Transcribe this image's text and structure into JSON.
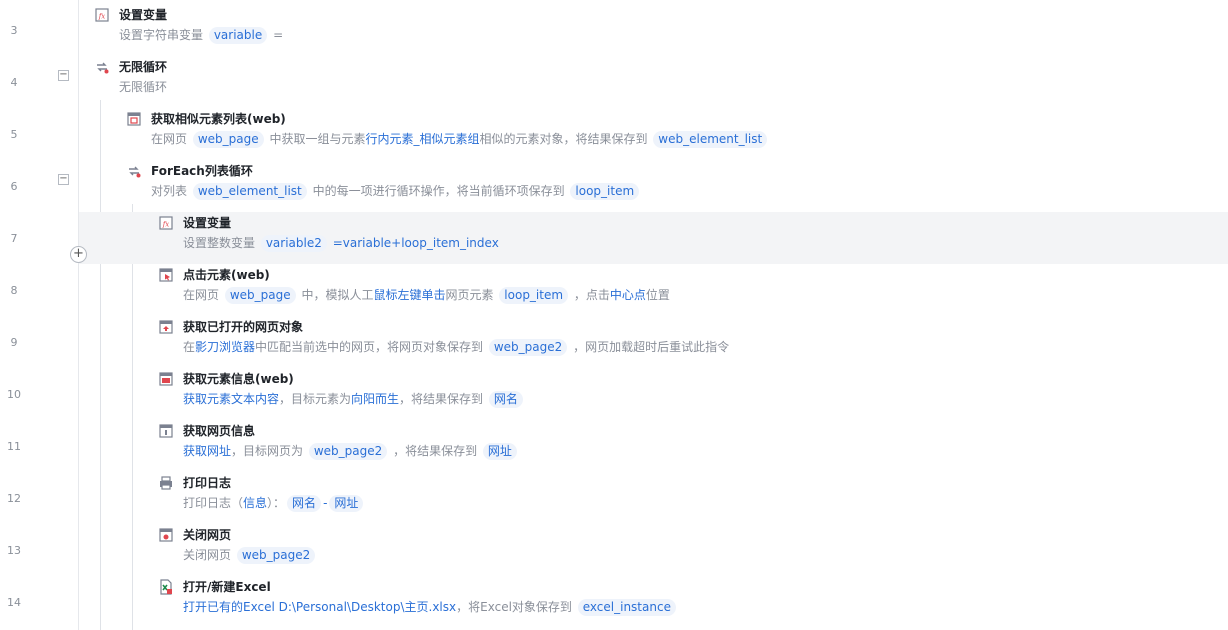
{
  "rows": [
    {
      "num": "3",
      "title": "设置变量",
      "desc": [
        "设置字符串变量 ",
        {
          "t": "variable"
        },
        " ="
      ]
    },
    {
      "num": "4",
      "title": "无限循环",
      "desc": [
        "无限循环"
      ]
    },
    {
      "num": "5",
      "title": "获取相似元素列表(web)",
      "desc": [
        "在网页 ",
        {
          "t": "web_page"
        },
        " 中获取一组与元素",
        {
          "b": "行内元素_相似元素组"
        },
        "相似的元素对象，将结果保存到 ",
        {
          "t": "web_element_list"
        }
      ]
    },
    {
      "num": "6",
      "title": "ForEach列表循环",
      "desc": [
        "对列表 ",
        {
          "t": "web_element_list"
        },
        " 中的每一项进行循环操作，将当前循环项保存到 ",
        {
          "t": "loop_item"
        }
      ]
    },
    {
      "num": "7",
      "title": "设置变量",
      "desc": [
        "设置整数变量 ",
        {
          "t": "variable2"
        },
        " ",
        {
          "b": "=variable+loop_item_index"
        }
      ]
    },
    {
      "num": "8",
      "title": "点击元素(web)",
      "desc": [
        "在网页 ",
        {
          "t": "web_page"
        },
        " 中，模拟人工",
        {
          "b": "鼠标左键单击"
        },
        "网页元素 ",
        {
          "t": "loop_item"
        },
        " ，点击",
        {
          "b": "中心点"
        },
        "位置"
      ]
    },
    {
      "num": "9",
      "title": "获取已打开的网页对象",
      "desc": [
        "在",
        {
          "b": "影刀浏览器"
        },
        "中匹配当前选中的网页，将网页对象保存到 ",
        {
          "t": "web_page2"
        },
        " ，网页加载超时后重试此指令"
      ]
    },
    {
      "num": "10",
      "title": "获取元素信息(web)",
      "desc": [
        {
          "b": "获取元素文本内容"
        },
        "，目标元素为",
        {
          "b": "向阳而生"
        },
        "，将结果保存到 ",
        {
          "t": "网名"
        }
      ]
    },
    {
      "num": "11",
      "title": "获取网页信息",
      "desc": [
        {
          "b": "获取网址"
        },
        "，目标网页为 ",
        {
          "t": "web_page2"
        },
        " ，将结果保存到 ",
        {
          "t": "网址"
        }
      ]
    },
    {
      "num": "12",
      "title": "打印日志",
      "desc": [
        "打印日志（",
        {
          "b": "信息"
        },
        "）：",
        {
          "t": "网名"
        },
        {
          "b": "-"
        },
        {
          "t": "网址"
        }
      ]
    },
    {
      "num": "13",
      "title": "关闭网页",
      "desc": [
        "关闭网页 ",
        {
          "t": "web_page2"
        }
      ]
    },
    {
      "num": "14",
      "title": "打开/新建Excel",
      "desc": [
        {
          "b": "打开已有的Excel D:\\Personal\\Desktop\\主页.xlsx"
        },
        "，将Excel对象保存到 ",
        {
          "t": "excel_instance"
        }
      ]
    }
  ],
  "fold_symbol": "−",
  "add_symbol": "+",
  "colors": {
    "accent": "#2a6fd6",
    "tag_bg": "#eef3fb",
    "highlight": "#f3f4f6"
  }
}
